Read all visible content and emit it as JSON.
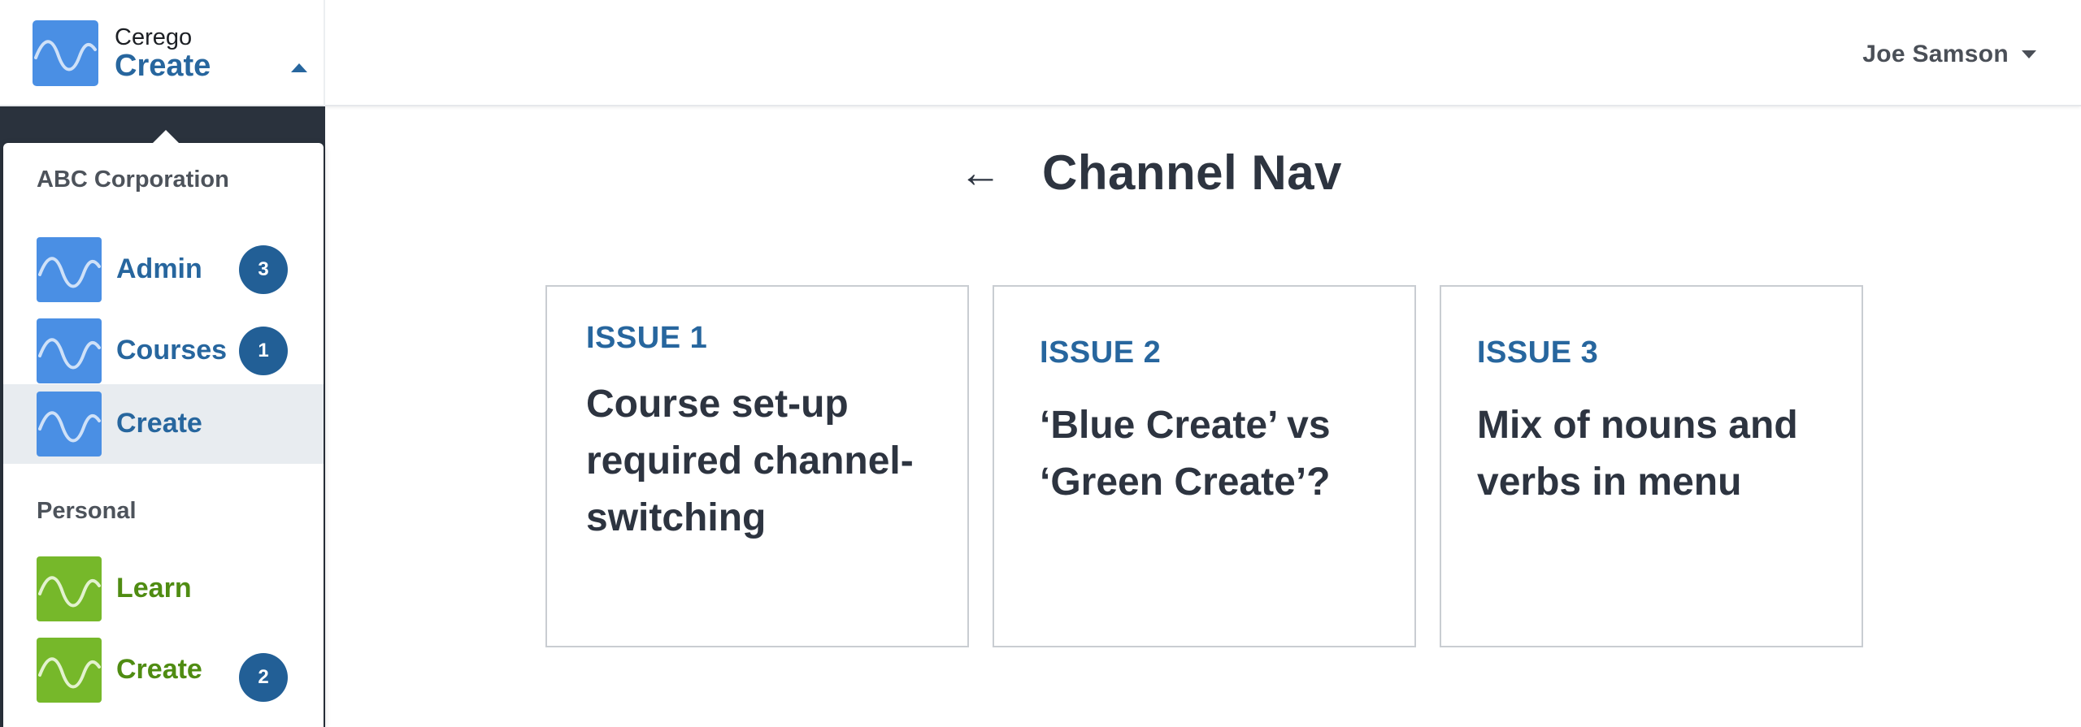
{
  "header": {
    "brand_small": "Cerego",
    "brand_big": "Create",
    "user_name": "Joe Samson"
  },
  "menu": {
    "org_section": "ABC Corporation",
    "org_items": [
      {
        "label": "Admin",
        "badge": "3"
      },
      {
        "label": "Courses",
        "badge": "1"
      },
      {
        "label": "Create",
        "badge": ""
      }
    ],
    "personal_section": "Personal",
    "personal_items": [
      {
        "label": "Learn",
        "badge": ""
      },
      {
        "label": "Create",
        "badge": "2"
      }
    ]
  },
  "main": {
    "back": "←",
    "title": "Channel Nav",
    "cards": [
      {
        "issue": "ISSUE 1",
        "lines": [
          "Course set-up",
          "required channel-",
          "switching"
        ]
      },
      {
        "issue": "ISSUE 2",
        "lines": [
          "‘Blue Create’ vs",
          "‘Green Create’?"
        ]
      },
      {
        "issue": "ISSUE 3",
        "lines": [
          "Mix of nouns and",
          "verbs in menu"
        ]
      }
    ]
  },
  "colors": {
    "blue_icon": "#4a8fe4",
    "green_icon": "#76b82a",
    "brand_blue": "#27669e",
    "badge": "#225f96",
    "dark_panel": "#2a323d"
  }
}
